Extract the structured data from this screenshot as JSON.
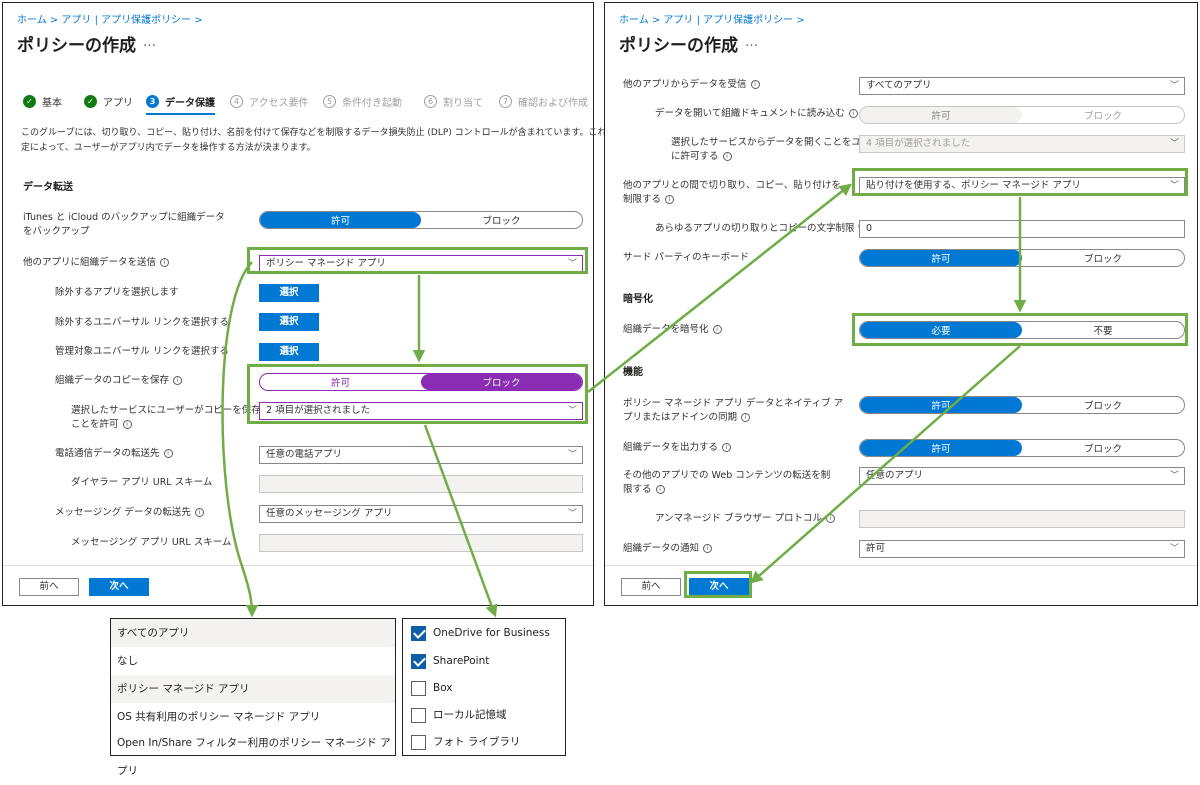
{
  "left": {
    "breadcrumb": "ホーム > アプリ | アプリ保護ポリシー >",
    "title": "ポリシーの作成",
    "more": "…",
    "steps": [
      {
        "num": "✓",
        "label": "基本"
      },
      {
        "num": "✓",
        "label": "アプリ"
      },
      {
        "num": "3",
        "label": "データ保護"
      },
      {
        "num": "4",
        "label": "アクセス要件"
      },
      {
        "num": "5",
        "label": "条件付き起動"
      },
      {
        "num": "6",
        "label": "割り当て"
      },
      {
        "num": "7",
        "label": "確認および作成"
      }
    ],
    "description_line1": "このグループには、切り取り、コピー、貼り付け、名前を付けて保存などを制限するデータ損失防止 (DLP) コントロールが含まれています。これらの設",
    "description_line2": "定によって、ユーザーがアプリ内でデータを操作する方法が決まります。",
    "section_transfer": "データ転送",
    "itunes_label_1": "iTunes と iCloud のバックアップに組織データ",
    "itunes_label_2": "をバックアップ",
    "allow": "許可",
    "block": "ブロック",
    "send_label": "他のアプリに組織データを送信",
    "send_value": "ポリシー マネージド アプリ",
    "exclude_apps_label": "除外するアプリを選択します",
    "exclude_universal_label": "除外するユニバーサル リンクを選択する",
    "managed_universal_label": "管理対象ユニバーサル リンクを選択する",
    "select_btn": "選択",
    "save_copy_label": "組織データのコピーを保存",
    "save_services_label_1": "選択したサービスにユーザーがコピーを保存する",
    "save_services_label_2": "ことを許可",
    "save_services_value": "2 項目が選択されました",
    "phone_label": "電話通信データの転送先",
    "phone_value": "任意の電話アプリ",
    "dialer_label": "ダイヤラー アプリ URL スキーム",
    "messaging_label": "メッセージング データの転送先",
    "messaging_value": "任意のメッセージング アプリ",
    "messaging_url_label": "メッセージング アプリ URL スキーム",
    "back_btn": "前へ",
    "next_btn": "次へ"
  },
  "right": {
    "breadcrumb": "ホーム > アプリ | アプリ保護ポリシー >",
    "title": "ポリシーの作成",
    "more": "…",
    "receive_label": "他のアプリからデータを受信",
    "receive_value": "すべてのアプリ",
    "open_into_label": "データを開いて組織ドキュメントに読み込む",
    "allow": "許可",
    "block": "ブロック",
    "open_services_label_1": "選択したサービスからデータを開くことをユーザー",
    "open_services_label_2": "に許可する",
    "open_services_value": "4 項目が選択されました",
    "cut_copy_label_1": "他のアプリとの間で切り取り、コピー、貼り付けを",
    "cut_copy_label_2": "制限する",
    "cut_copy_value": "貼り付けを使用する、ポリシー マネージド アプリ",
    "char_limit_label": "あらゆるアプリの切り取りとコピーの文字制限",
    "required_mark": "*",
    "char_limit_value": "0",
    "keyboard_label": "サード パーティのキーボード",
    "section_encryption": "暗号化",
    "encrypt_label": "組織データを暗号化",
    "required": "必要",
    "not_required": "不要",
    "section_features": "機能",
    "sync_label_1": "ポリシー マネージド アプリ データとネイティブ ア",
    "sync_label_2": "プリまたはアドインの同期",
    "print_label": "組織データを出力する",
    "web_label_1": "その他のアプリでの Web コンテンツの転送を制",
    "web_label_2": "限する",
    "web_value": "任意のアプリ",
    "unmanaged_browser_label": "アンマネージド ブラウザー プロトコル",
    "notify_label": "組織データの通知",
    "notify_value": "許可",
    "back_btn": "前へ",
    "next_btn": "次へ"
  },
  "dropdown_options": [
    "すべてのアプリ",
    "なし",
    "ポリシー マネージド アプリ",
    "OS 共有利用のポリシー マネージド アプリ",
    "Open In/Share フィルター利用のポリシー マネージド アプリ"
  ],
  "storage_options": [
    {
      "label": "OneDrive for Business",
      "checked": true
    },
    {
      "label": "SharePoint",
      "checked": true
    },
    {
      "label": "Box",
      "checked": false
    },
    {
      "label": "ローカル記憶域",
      "checked": false
    },
    {
      "label": "フォト ライブラリ",
      "checked": false
    }
  ],
  "colors": {
    "accent": "#0078d4",
    "purple": "#8a2bb3",
    "callout": "#70ad47",
    "success": "#107c10"
  }
}
